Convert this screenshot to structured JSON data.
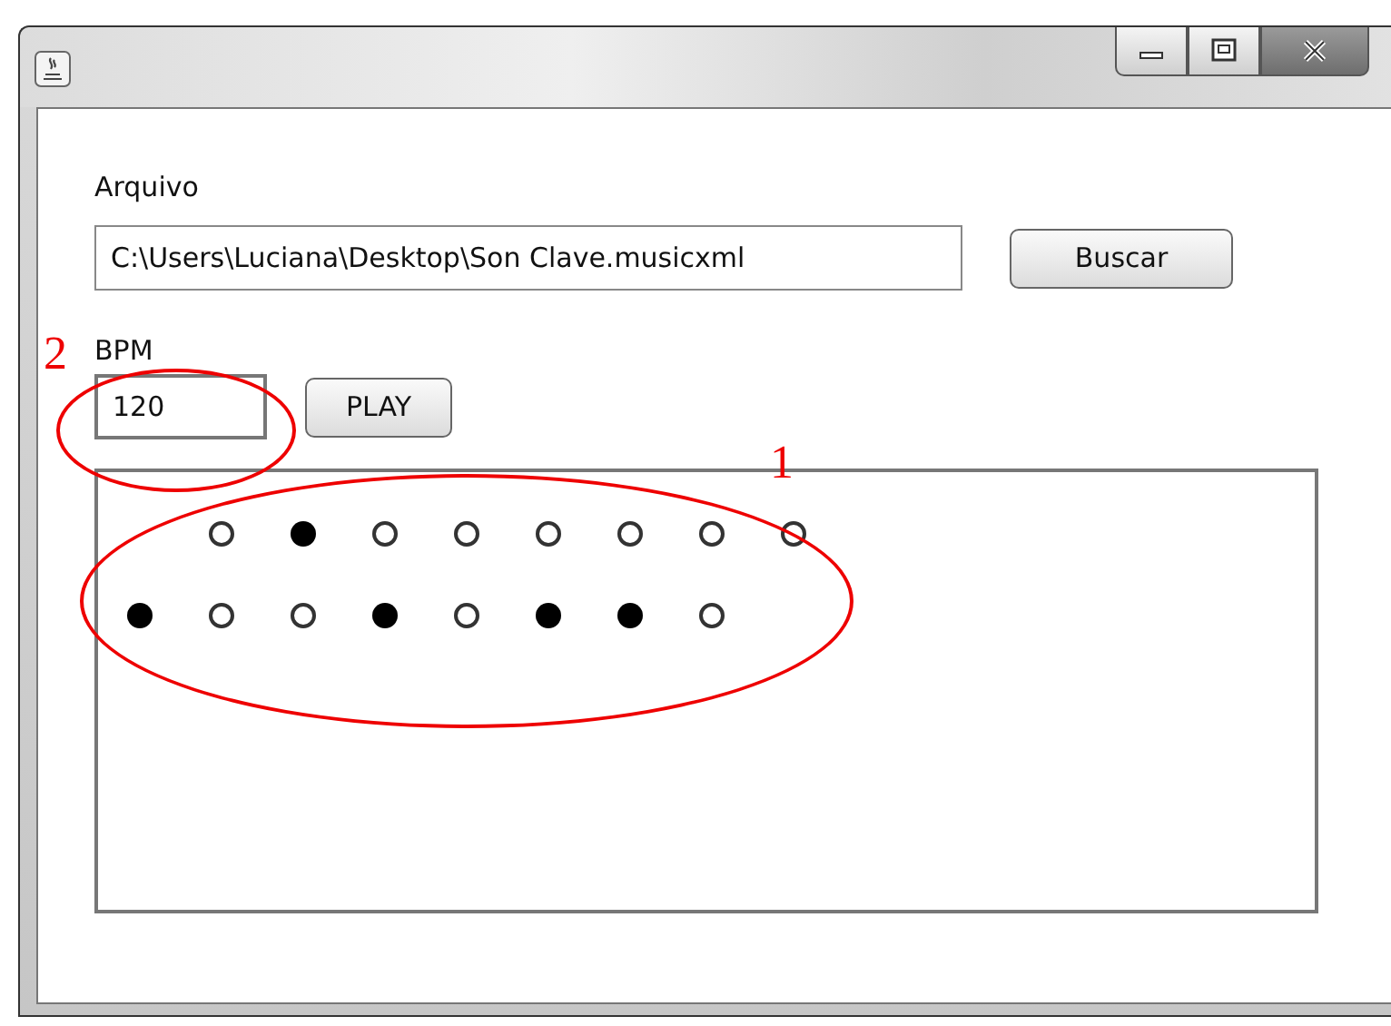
{
  "file_label": "Arquivo",
  "file_path": "C:\\Users\\Luciana\\Desktop\\Son Clave.musicxml",
  "browse_button": "Buscar",
  "bpm_label": "BPM",
  "bpm_value": "120",
  "play_button": "PLAY",
  "pattern": {
    "rows": [
      {
        "beats": [
          {
            "kind": "gap"
          },
          {
            "kind": "dot",
            "filled": false
          },
          {
            "kind": "dot",
            "filled": true
          },
          {
            "kind": "dot",
            "filled": false
          },
          {
            "kind": "dot",
            "filled": false
          },
          {
            "kind": "dot",
            "filled": false
          },
          {
            "kind": "dot",
            "filled": false
          },
          {
            "kind": "dot",
            "filled": false
          },
          {
            "kind": "dot",
            "filled": false
          }
        ]
      },
      {
        "beats": [
          {
            "kind": "dot",
            "filled": true
          },
          {
            "kind": "dot",
            "filled": false
          },
          {
            "kind": "dot",
            "filled": false
          },
          {
            "kind": "dot",
            "filled": true
          },
          {
            "kind": "dot",
            "filled": false
          },
          {
            "kind": "dot",
            "filled": true
          },
          {
            "kind": "dot",
            "filled": true
          },
          {
            "kind": "dot",
            "filled": false
          }
        ]
      }
    ]
  },
  "annotations": [
    {
      "kind": "bpm",
      "label": "2"
    },
    {
      "kind": "pattern",
      "label": "1"
    }
  ]
}
